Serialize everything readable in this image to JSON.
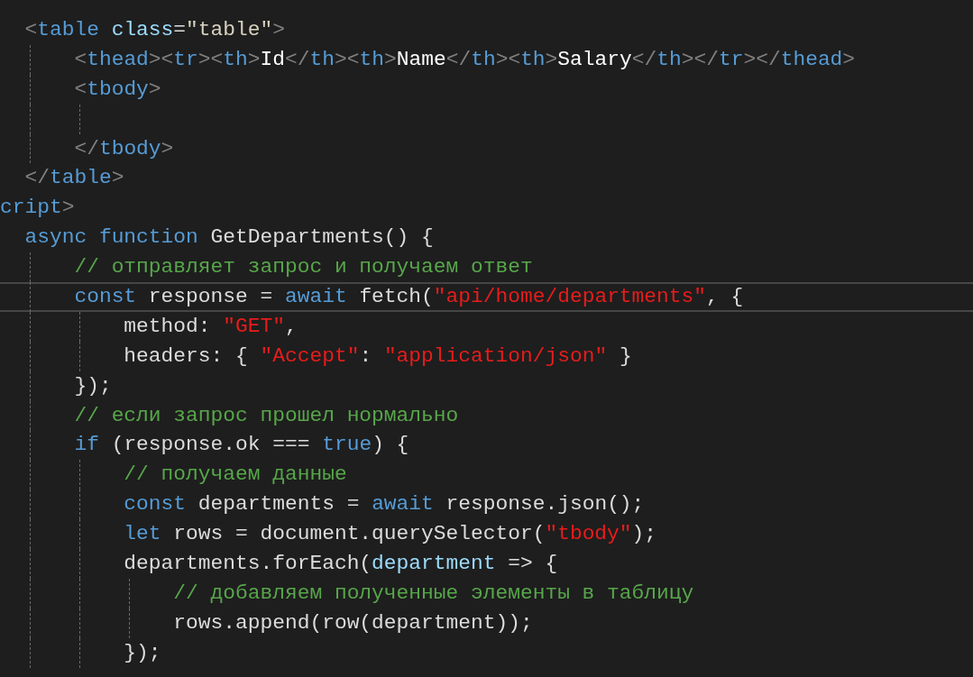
{
  "editor": {
    "lines": [
      {
        "highlighted": false,
        "tokens": [
          {
            "kind": "punct",
            "t": "  <"
          },
          {
            "kind": "tag",
            "t": "table"
          },
          {
            "kind": "attr",
            "t": " class"
          },
          {
            "kind": "plain",
            "t": "="
          },
          {
            "kind": "value",
            "t": "\"table\""
          },
          {
            "kind": "punct",
            "t": ">"
          }
        ]
      },
      {
        "highlighted": false,
        "tokens": [
          {
            "kind": "punct",
            "t": "      <"
          },
          {
            "kind": "tag",
            "t": "thead"
          },
          {
            "kind": "punct",
            "t": "><"
          },
          {
            "kind": "tag",
            "t": "tr"
          },
          {
            "kind": "punct",
            "t": "><"
          },
          {
            "kind": "tag",
            "t": "th"
          },
          {
            "kind": "punct",
            "t": ">"
          },
          {
            "kind": "text",
            "t": "Id"
          },
          {
            "kind": "punct",
            "t": "</"
          },
          {
            "kind": "tag",
            "t": "th"
          },
          {
            "kind": "punct",
            "t": "><"
          },
          {
            "kind": "tag",
            "t": "th"
          },
          {
            "kind": "punct",
            "t": ">"
          },
          {
            "kind": "text",
            "t": "Name"
          },
          {
            "kind": "punct",
            "t": "</"
          },
          {
            "kind": "tag",
            "t": "th"
          },
          {
            "kind": "punct",
            "t": "><"
          },
          {
            "kind": "tag",
            "t": "th"
          },
          {
            "kind": "punct",
            "t": ">"
          },
          {
            "kind": "text",
            "t": "Salary"
          },
          {
            "kind": "punct",
            "t": "</"
          },
          {
            "kind": "tag",
            "t": "th"
          },
          {
            "kind": "punct",
            "t": "></"
          },
          {
            "kind": "tag",
            "t": "tr"
          },
          {
            "kind": "punct",
            "t": "></"
          },
          {
            "kind": "tag",
            "t": "thead"
          },
          {
            "kind": "punct",
            "t": ">"
          }
        ]
      },
      {
        "highlighted": false,
        "tokens": [
          {
            "kind": "punct",
            "t": "      <"
          },
          {
            "kind": "tag",
            "t": "tbody"
          },
          {
            "kind": "punct",
            "t": ">"
          }
        ]
      },
      {
        "highlighted": false
      },
      {
        "highlighted": false,
        "tokens": [
          {
            "kind": "punct",
            "t": "      </"
          },
          {
            "kind": "tag",
            "t": "tbody"
          },
          {
            "kind": "punct",
            "t": ">"
          }
        ]
      },
      {
        "highlighted": false,
        "tokens": [
          {
            "kind": "punct",
            "t": "  </"
          },
          {
            "kind": "tag",
            "t": "table"
          },
          {
            "kind": "punct",
            "t": ">"
          }
        ]
      },
      {
        "highlighted": false,
        "tokens": [
          {
            "kind": "tag",
            "t": "cript"
          },
          {
            "kind": "punct",
            "t": ">"
          }
        ]
      },
      {
        "highlighted": false,
        "tokens": [
          {
            "kind": "keyword",
            "t": "  async function"
          },
          {
            "kind": "plain",
            "t": " GetDepartments() {"
          }
        ]
      },
      {
        "highlighted": false,
        "tokens": [
          {
            "kind": "comment",
            "t": "      // отправляет запрос и получаем ответ"
          }
        ]
      },
      {
        "highlighted": true,
        "tokens": [
          {
            "kind": "keyword",
            "t": "      const"
          },
          {
            "kind": "plain",
            "t": " response = "
          },
          {
            "kind": "keyword",
            "t": "await"
          },
          {
            "kind": "plain",
            "t": " fetch("
          },
          {
            "kind": "string",
            "t": "\"api/home/departments\""
          },
          {
            "kind": "plain",
            "t": ", {"
          }
        ]
      },
      {
        "highlighted": false,
        "tokens": [
          {
            "kind": "plain",
            "t": "          method: "
          },
          {
            "kind": "string",
            "t": "\"GET\""
          },
          {
            "kind": "plain",
            "t": ","
          }
        ]
      },
      {
        "highlighted": false,
        "tokens": [
          {
            "kind": "plain",
            "t": "          headers: { "
          },
          {
            "kind": "string",
            "t": "\"Accept\""
          },
          {
            "kind": "plain",
            "t": ": "
          },
          {
            "kind": "string",
            "t": "\"application/json\""
          },
          {
            "kind": "plain",
            "t": " }"
          }
        ]
      },
      {
        "highlighted": false,
        "tokens": [
          {
            "kind": "plain",
            "t": "      });"
          }
        ]
      },
      {
        "highlighted": false,
        "tokens": [
          {
            "kind": "comment",
            "t": "      // если запрос прошел нормально"
          }
        ]
      },
      {
        "highlighted": false,
        "tokens": [
          {
            "kind": "keyword",
            "t": "      if"
          },
          {
            "kind": "plain",
            "t": " (response.ok === "
          },
          {
            "kind": "keyword",
            "t": "true"
          },
          {
            "kind": "plain",
            "t": ") {"
          }
        ]
      },
      {
        "highlighted": false,
        "tokens": [
          {
            "kind": "comment",
            "t": "          // получаем данные"
          }
        ]
      },
      {
        "highlighted": false,
        "tokens": [
          {
            "kind": "keyword",
            "t": "          const"
          },
          {
            "kind": "plain",
            "t": " departments = "
          },
          {
            "kind": "keyword",
            "t": "await"
          },
          {
            "kind": "plain",
            "t": " response.json();"
          }
        ]
      },
      {
        "highlighted": false,
        "tokens": [
          {
            "kind": "keyword",
            "t": "          let"
          },
          {
            "kind": "plain",
            "t": " rows = document.querySelector("
          },
          {
            "kind": "string",
            "t": "\"tbody\""
          },
          {
            "kind": "plain",
            "t": ");"
          }
        ]
      },
      {
        "highlighted": false,
        "tokens": [
          {
            "kind": "plain",
            "t": "          departments.forEach("
          },
          {
            "kind": "param",
            "t": "department"
          },
          {
            "kind": "plain",
            "t": " => {"
          }
        ]
      },
      {
        "highlighted": false,
        "tokens": [
          {
            "kind": "comment",
            "t": "              // добавляем полученные элементы в таблицу"
          }
        ]
      },
      {
        "highlighted": false,
        "tokens": [
          {
            "kind": "plain",
            "t": "              rows.append(row(department));"
          }
        ]
      },
      {
        "highlighted": false,
        "tokens": [
          {
            "kind": "plain",
            "t": "          });"
          }
        ]
      }
    ]
  }
}
